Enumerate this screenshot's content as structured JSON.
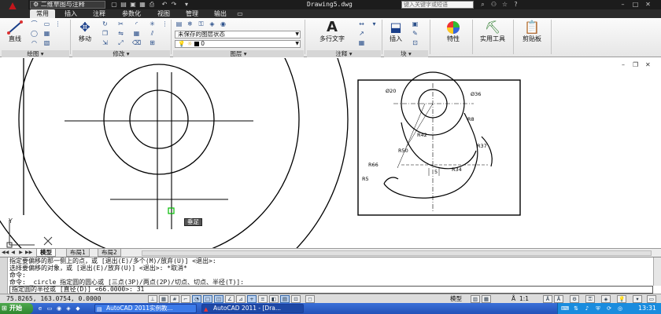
{
  "window": {
    "workspace": "二维草图与注释",
    "document_title": "Drawing5.dwg",
    "search_placeholder": "键入关键字或短语"
  },
  "ribbon_tabs": [
    "常用",
    "插入",
    "注释",
    "参数化",
    "视图",
    "管理",
    "输出"
  ],
  "ribbon": {
    "draw": {
      "title": "绘图",
      "line_label": "直线"
    },
    "modify": {
      "title": "修改",
      "move_label": "移动"
    },
    "layers": {
      "title": "图层",
      "layer_state": "未保存的图层状态",
      "current_layer": "0"
    },
    "annotation": {
      "title": "注释",
      "mtext_label": "多行文字"
    },
    "block": {
      "title": "块",
      "insert_label": "插入"
    },
    "properties_label": "特性",
    "utilities_label": "实用工具",
    "clipboard_label": "剪贴板"
  },
  "drawing": {
    "tooltip": "垂足",
    "dimensions": {
      "d20": "Ø20",
      "d36": "Ø36",
      "r8": "R8",
      "r42": "R42",
      "r50": "R50",
      "r37": "R37",
      "r66": "R66",
      "r34": "R34",
      "r5": "R5",
      "dim5": "5"
    },
    "axis_y": "Y",
    "axis_x": "X"
  },
  "layout_tabs": [
    "模型",
    "布局1",
    "布局2"
  ],
  "command": {
    "lines": [
      "指定要偏移的那一侧上的点，或 [退出(E)/多个(M)/放弃(U)] <退出>:",
      "选择要偏移的对象，或 [退出(E)/放弃(U)] <退出>:  *取消*",
      "命令:",
      "命令:  _circle 指定圆的圆心或 [三点(3P)/两点(2P)/切点、切点、半径(T)]:"
    ],
    "input": "指定圆的半径或 [直径(D)] <66.0000>: 31"
  },
  "status": {
    "coords": "75.8265,  163.0754,  0.0000",
    "model_label": "模型",
    "scale": "1:1"
  },
  "taskbar": {
    "start_label": "开始",
    "tasks": [
      "AutoCAD 2011实例教...",
      "AutoCAD 2011 - [Dra..."
    ],
    "clock": "13:31"
  }
}
